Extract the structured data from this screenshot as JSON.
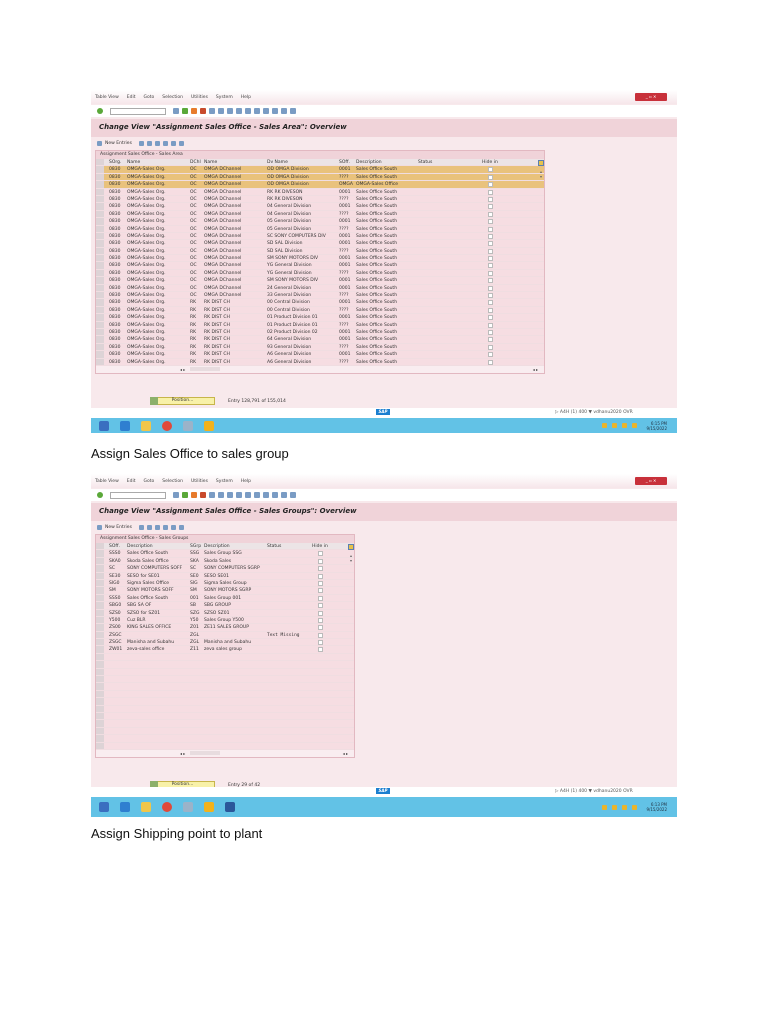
{
  "screen1": {
    "menu": [
      "Table View",
      "Edit",
      "Goto",
      "Selection",
      "Utilities",
      "System",
      "Help"
    ],
    "title": "Change View \"Assignment Sales Office - Sales Area\": Overview",
    "new_entries": "New Entries",
    "table_caption": "Assignment Sales Office - Sales Area",
    "columns": [
      "SOrg.",
      "Name",
      "DChl",
      "Name",
      "Dv Name",
      "SOff.",
      "Description",
      "Status",
      "Hide in"
    ],
    "rows": [
      [
        "0830",
        "OMGA-Sales Org.",
        "OC",
        "OMGA DChannel",
        "OD OMGA Division",
        "0001",
        "Sales Office South"
      ],
      [
        "0830",
        "OMGA-Sales Org.",
        "OC",
        "OMGA DChannel",
        "OD OMGA Division",
        "????",
        "Sales Office South"
      ],
      [
        "0830",
        "OMGA-Sales Org.",
        "OC",
        "OMGA DChannel",
        "OD OMGA Division",
        "OMGA",
        "OMGA-Sales Office"
      ],
      [
        "0830",
        "OMGA-Sales Org.",
        "OC",
        "OMGA DChannel",
        "RK RK DIVESON",
        "0001",
        "Sales Office South"
      ],
      [
        "0830",
        "OMGA-Sales Org.",
        "OC",
        "OMGA DChannel",
        "RK RK DIVESON",
        "????",
        "Sales Office South"
      ],
      [
        "0830",
        "OMGA-Sales Org.",
        "OC",
        "OMGA DChannel",
        "04 General Division",
        "0001",
        "Sales Office South"
      ],
      [
        "0830",
        "OMGA-Sales Org.",
        "OC",
        "OMGA DChannel",
        "04 General Division",
        "????",
        "Sales Office South"
      ],
      [
        "0830",
        "OMGA-Sales Org.",
        "OC",
        "OMGA DChannel",
        "05 General Division",
        "0001",
        "Sales Office South"
      ],
      [
        "0830",
        "OMGA-Sales Org.",
        "OC",
        "OMGA DChannel",
        "05 General Division",
        "????",
        "Sales Office South"
      ],
      [
        "0830",
        "OMGA-Sales Org.",
        "OC",
        "OMGA DChannel",
        "SC SONY COMPUTERS DIV",
        "0001",
        "Sales Office South"
      ],
      [
        "0830",
        "OMGA-Sales Org.",
        "OC",
        "OMGA DChannel",
        "SD SAL Division",
        "0001",
        "Sales Office South"
      ],
      [
        "0830",
        "OMGA-Sales Org.",
        "OC",
        "OMGA DChannel",
        "SD SAL Division",
        "????",
        "Sales Office South"
      ],
      [
        "0830",
        "OMGA-Sales Org.",
        "OC",
        "OMGA DChannel",
        "SM SONY MOTORS DIV",
        "0001",
        "Sales Office South"
      ],
      [
        "0830",
        "OMGA-Sales Org.",
        "OC",
        "OMGA DChannel",
        "YG General Division",
        "0001",
        "Sales Office South"
      ],
      [
        "0830",
        "OMGA-Sales Org.",
        "OC",
        "OMGA DChannel",
        "YG General Division",
        "????",
        "Sales Office South"
      ],
      [
        "0830",
        "OMGA-Sales Org.",
        "OC",
        "OMGA DChannel",
        "SM SONY MOTORS DIV",
        "0001",
        "Sales Office South"
      ],
      [
        "0830",
        "OMGA-Sales Org.",
        "OC",
        "OMGA DChannel",
        "24 General Division",
        "0001",
        "Sales Office South"
      ],
      [
        "0830",
        "OMGA-Sales Org.",
        "OC",
        "OMGA DChannel",
        "33 General Division",
        "????",
        "Sales Office South"
      ],
      [
        "0830",
        "OMGA-Sales Org.",
        "RK",
        "RK DIST CH",
        "00 Central Division",
        "0001",
        "Sales Office South"
      ],
      [
        "0830",
        "OMGA-Sales Org.",
        "RK",
        "RK DIST CH",
        "00 Central Division",
        "????",
        "Sales Office South"
      ],
      [
        "0830",
        "OMGA-Sales Org.",
        "RK",
        "RK DIST CH",
        "01 Product Division 01",
        "0001",
        "Sales Office South"
      ],
      [
        "0830",
        "OMGA-Sales Org.",
        "RK",
        "RK DIST CH",
        "01 Product Division 01",
        "????",
        "Sales Office South"
      ],
      [
        "0830",
        "OMGA-Sales Org.",
        "RK",
        "RK DIST CH",
        "02 Product Division 02",
        "0001",
        "Sales Office South"
      ],
      [
        "0830",
        "OMGA-Sales Org.",
        "RK",
        "RK DIST CH",
        "64 General Division",
        "0001",
        "Sales Office South"
      ],
      [
        "0830",
        "OMGA-Sales Org.",
        "RK",
        "RK DIST CH",
        "93 General Division",
        "????",
        "Sales Office South"
      ],
      [
        "0830",
        "OMGA-Sales Org.",
        "RK",
        "RK DIST CH",
        "A6 General Division",
        "0001",
        "Sales Office South"
      ],
      [
        "0830",
        "OMGA-Sales Org.",
        "RK",
        "RK DIST CH",
        "A6 General Division",
        "????",
        "Sales Office South"
      ]
    ],
    "highlighted_rows": 3,
    "position_label": "Position...",
    "entry_text": "Entry 128,791 of 155,014",
    "sap_logo": "SAP",
    "sysinfo": "▷ A4H (1) 400 ▼  vdhanu2020  OVR",
    "time": "6:15 PM",
    "date": "9/15/2022"
  },
  "caption1": "Assign Sales Office to sales group",
  "screen2": {
    "menu": [
      "Table View",
      "Edit",
      "Goto",
      "Selection",
      "Utilities",
      "System",
      "Help"
    ],
    "title": "Change View \"Assignment Sales Office - Sales Groups\": Overview",
    "new_entries": "New Entries",
    "table_caption": "Assignment Sales Office - Sales Groups",
    "columns": [
      "SOff.",
      "Description",
      "SGrp",
      "Description",
      "Status",
      "Hide in"
    ],
    "rows": [
      [
        "SSS0",
        "Sales Office South",
        "SSG",
        "Sales Group SSG",
        ""
      ],
      [
        "SKA0",
        "Skoda Sales Office",
        "SKA",
        "Skoda Sales",
        ""
      ],
      [
        "SC",
        "SONY COMPUTERS SOFF",
        "SC",
        "SONY COMPUTERS SGRP",
        ""
      ],
      [
        "SE30",
        "SESO for SE01",
        "SE0",
        "SESO SE01",
        ""
      ],
      [
        "SIG0",
        "Sigma Sales Office",
        "SIG",
        "Sigma Sales Group",
        ""
      ],
      [
        "SM",
        "SONY MOTORS SOFF",
        "SM",
        "SONY MOTORS SGRP",
        ""
      ],
      [
        "SSS0",
        "Sales Office South",
        "001",
        "Sales Group 001",
        ""
      ],
      [
        "SBG0",
        "SBG SA OF",
        "SB",
        "SBG GROUP",
        ""
      ],
      [
        "SZS0",
        "SZSO for SZ01",
        "SZG",
        "SZSO SZ01",
        ""
      ],
      [
        "Y500",
        "Cuz BLR",
        "Y50",
        "Sales Group Y500",
        ""
      ],
      [
        "ZS00",
        "KING SALES  OFFICE",
        "Z01",
        "ZE11 SALES  GROUP",
        ""
      ],
      [
        "ZSGC",
        "",
        "ZGL",
        "",
        "Text Missing"
      ],
      [
        "ZSGC",
        "Manisha and Subahu",
        "ZGL",
        "Manisha and Subahu",
        ""
      ],
      [
        "ZW01",
        "zeva-sales office",
        "Z11",
        "zeva sales group",
        ""
      ]
    ],
    "empty_rows": 13,
    "position_label": "Position...",
    "entry_text": "Entry 29 of 42",
    "sap_logo": "SAP",
    "sysinfo": "▷ A4H (1) 400 ▼  vdhanu2020  OVR",
    "time": "6:13 PM",
    "date": "9/15/2022"
  },
  "caption2": "Assign Shipping point to plant",
  "colors": {
    "taskbar": "#62c2e6",
    "highlight": "#e9c27c",
    "row": "#f6dde2",
    "close": "#c8303a"
  }
}
